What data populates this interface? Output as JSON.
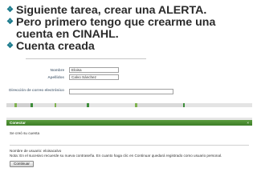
{
  "slide": {
    "bullet_marker": "❖",
    "bullets": [
      "Siguiente tarea, crear una ALERTA.",
      "Pero primero tengo que crearme una cuenta en CINAHL.",
      "Cuenta creada"
    ]
  },
  "form_screenshot": {
    "fields": [
      {
        "label": "Nombre",
        "value": "Eloisa"
      },
      {
        "label": "Apellidos",
        "value": "Calvo Sánchez"
      },
      {
        "label": "Dirección de correo electrónico",
        "value": ""
      }
    ]
  },
  "confirmation_screenshot": {
    "header_title": "Conectar",
    "close_label": "×",
    "created_message": "Se creó su cuenta",
    "username_line": "Nombre de usuario: eloisacalvo",
    "note_line": "Nota: En el sucesivo recuerde su nueva contraseña. En cuanto haga clic en Continuar quedará registrado como usuario personal.",
    "continue_label": "Continuar"
  },
  "colors": {
    "bullet_marker": "#1a7a8c",
    "header_green": "#4a8c33",
    "label_gray_blue": "#6a7a8a"
  }
}
